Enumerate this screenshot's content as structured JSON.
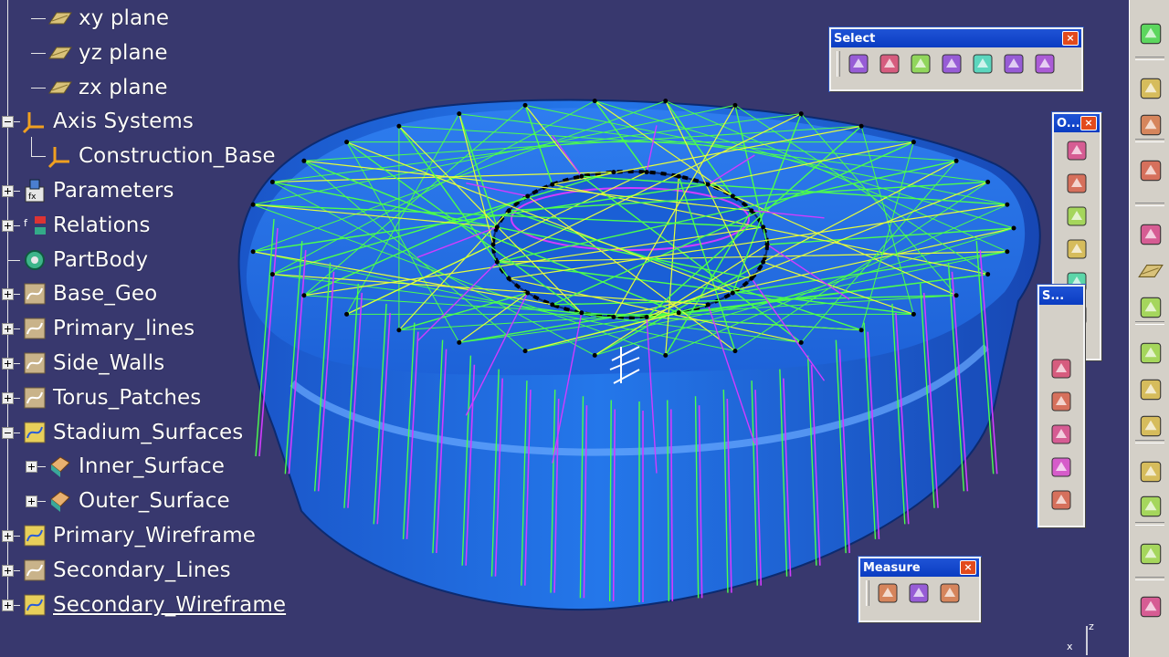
{
  "tree": {
    "nodes": [
      {
        "label": "xy plane",
        "icon": "plane-icon"
      },
      {
        "label": "yz plane",
        "icon": "plane-icon"
      },
      {
        "label": "zx plane",
        "icon": "plane-icon"
      },
      {
        "label": "Axis Systems",
        "icon": "axis-system-icon"
      },
      {
        "label": "Construction_Base",
        "icon": "axis-system-icon"
      },
      {
        "label": "Parameters",
        "icon": "parameters-icon"
      },
      {
        "label": "Relations",
        "icon": "relations-icon"
      },
      {
        "label": "PartBody",
        "icon": "gear-body-icon"
      },
      {
        "label": "Base_Geo",
        "icon": "geometrical-set-icon"
      },
      {
        "label": "Primary_lines",
        "icon": "geometrical-set-icon"
      },
      {
        "label": "Side_Walls",
        "icon": "geometrical-set-icon"
      },
      {
        "label": "Torus_Patches",
        "icon": "geometrical-set-icon"
      },
      {
        "label": "Stadium_Surfaces",
        "icon": "geometrical-set-active-icon"
      },
      {
        "label": "Inner_Surface",
        "icon": "surface-icon"
      },
      {
        "label": "Outer_Surface",
        "icon": "surface-icon"
      },
      {
        "label": "Primary_Wireframe",
        "icon": "geometrical-set-active-icon"
      },
      {
        "label": "Secondary_Lines",
        "icon": "geometrical-set-icon"
      },
      {
        "label": "Secondary_Wireframe",
        "icon": "geometrical-set-active-icon"
      }
    ]
  },
  "toolbars": {
    "select": {
      "title": "Select",
      "close": "×",
      "icons": [
        "select-arrow-icon",
        "selection-trap-icon",
        "intersecting-trap-icon",
        "polygon-trap-icon",
        "paint-stroke-select-icon",
        "outside-trap-icon",
        "outside-intersect-trap-icon"
      ]
    },
    "operations": {
      "title": "O...",
      "close": "×",
      "icons": [
        "join-icon",
        "split-icon",
        "extract-icon",
        "fillet-icon",
        "translate-icon",
        "extrapolate-icon"
      ]
    },
    "surfaces": {
      "title": "S...",
      "icons": [
        "offset-surface-icon",
        "sweep-icon",
        "fill-icon",
        "multi-section-icon",
        "blend-icon"
      ]
    },
    "measure": {
      "title": "Measure",
      "close": "×",
      "icons": [
        "measure-between-icon",
        "measure-item-icon",
        "measure-inertia-icon"
      ]
    }
  },
  "right_strip": {
    "icons": [
      "sketcher-icon",
      "select-icon",
      "sketch-analysis-icon",
      "point-icon",
      "line-icon",
      "plane-icon",
      "extrude-icon",
      "revolve-icon",
      "sphere-icon",
      "circle-icon",
      "spline-icon",
      "connect-icon",
      "project-icon",
      "grid-icon"
    ]
  },
  "compass": {
    "x": "x",
    "z": "z"
  },
  "colors": {
    "background": "#38386e",
    "surface": "#1f6de0",
    "wire_green": "#4cff4c",
    "wire_yellow": "#e8ff3a",
    "wire_magenta": "#d23cff",
    "toolbar_title": "#0a3cc2"
  }
}
